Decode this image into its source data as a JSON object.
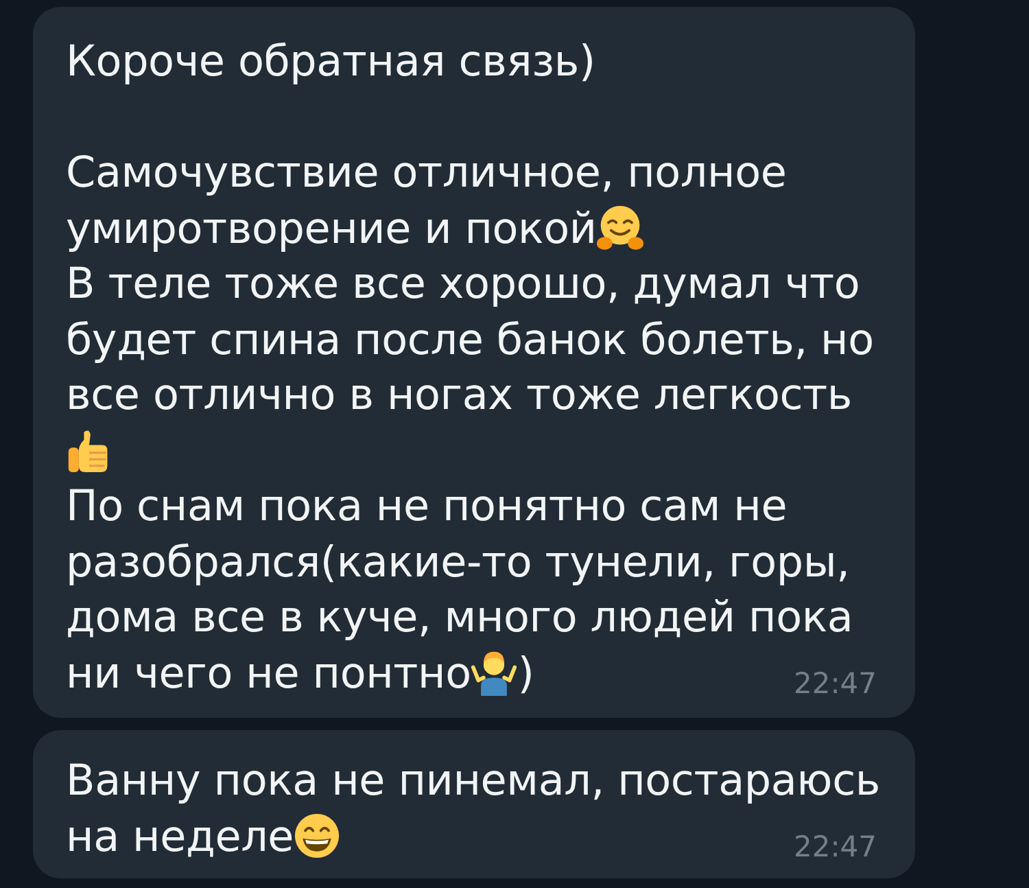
{
  "messages": [
    {
      "lines": [
        {
          "kind": "text",
          "segments": [
            {
              "kind": "text",
              "text": "Короче обратная связь)"
            }
          ]
        },
        {
          "kind": "blank"
        },
        {
          "kind": "text",
          "segments": [
            {
              "kind": "text",
              "text": "Самочувствие отличное, полное"
            }
          ]
        },
        {
          "kind": "text",
          "segments": [
            {
              "kind": "text",
              "text": "умиротворение и покой"
            },
            {
              "kind": "hug"
            }
          ]
        },
        {
          "kind": "text",
          "segments": [
            {
              "kind": "text",
              "text": "В теле тоже все хорошо, думал что"
            }
          ]
        },
        {
          "kind": "text",
          "segments": [
            {
              "kind": "text",
              "text": "будет спина после банок болеть, но"
            }
          ]
        },
        {
          "kind": "text",
          "segments": [
            {
              "kind": "text",
              "text": "все отлично в ногах тоже легкость"
            }
          ]
        },
        {
          "kind": "text",
          "segments": [
            {
              "kind": "thumbs"
            }
          ]
        },
        {
          "kind": "text",
          "segments": [
            {
              "kind": "text",
              "text": "По снам пока не понятно сам не"
            }
          ]
        },
        {
          "kind": "text",
          "segments": [
            {
              "kind": "text",
              "text": "разобрался(какие-то тунели, горы,"
            }
          ]
        },
        {
          "kind": "text",
          "segments": [
            {
              "kind": "text",
              "text": "дома все в куче, много людей пока"
            }
          ]
        },
        {
          "kind": "text",
          "segments": [
            {
              "kind": "text",
              "text": "ни чего не понтно"
            },
            {
              "kind": "shrug"
            },
            {
              "kind": "text",
              "text": ")"
            }
          ]
        }
      ],
      "time": "22:47"
    },
    {
      "lines": [
        {
          "kind": "text",
          "segments": [
            {
              "kind": "text",
              "text": "Ванну пока не пинемал, постараюсь"
            }
          ]
        },
        {
          "kind": "text",
          "segments": [
            {
              "kind": "text",
              "text": "на неделе"
            },
            {
              "kind": "grin"
            }
          ]
        }
      ],
      "time": "22:47"
    }
  ]
}
